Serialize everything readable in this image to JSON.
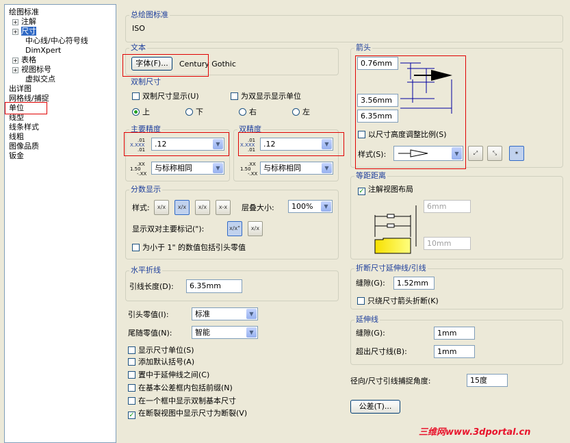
{
  "tree": {
    "items": [
      {
        "label": "绘图标准",
        "expander": ""
      },
      {
        "label": "注解",
        "expander": "+"
      },
      {
        "label": "尺寸",
        "expander": "+"
      },
      {
        "label": "中心线/中心符号线",
        "expander": ""
      },
      {
        "label": "DimXpert",
        "expander": ""
      },
      {
        "label": "表格",
        "expander": "+"
      },
      {
        "label": "视图标号",
        "expander": "+"
      },
      {
        "label": "虚拟交点",
        "expander": ""
      },
      {
        "label": "出详图",
        "expander": ""
      },
      {
        "label": "网格线/捕捉",
        "expander": ""
      },
      {
        "label": "单位",
        "expander": ""
      },
      {
        "label": "线型",
        "expander": ""
      },
      {
        "label": "线条样式",
        "expander": ""
      },
      {
        "label": "线粗",
        "expander": ""
      },
      {
        "label": "图像品质",
        "expander": ""
      },
      {
        "label": "钣金",
        "expander": ""
      }
    ]
  },
  "standard": {
    "label": "总绘图标准",
    "value": "ISO"
  },
  "text": {
    "label": "文本",
    "font_button": "字体(F)...",
    "font_name": "Century Gothic"
  },
  "dual": {
    "label": "双制尺寸",
    "show_dual": "双制尺寸显示(U)",
    "show_units": "为双显示显示单位",
    "top": "上",
    "bottom": "下",
    "right": "右",
    "left": "左"
  },
  "primary": {
    "label": "主要精度",
    "value": ".12",
    "tol": "与标称相同",
    "icon_top": ".01",
    "icon_mid": "X.XXX",
    "icon_bot": ".01",
    "tol_icon_top": ".XX",
    "tol_icon_mid": "1.50",
    "tol_icon_bot": "-.XX"
  },
  "dual_prec": {
    "label": "双精度",
    "value": ".12",
    "tol": "与标称相同",
    "icon_top": ".01",
    "icon_mid": "X.XXX",
    "icon_bot": ".01",
    "tol_icon_top": ".XX",
    "tol_icon_mid": "1.50",
    "tol_icon_bot": "-.XX"
  },
  "fraction": {
    "label": "分数显示",
    "style_label": "样式:",
    "stack_label": "层叠大小:",
    "stack_value": "100%",
    "dual_label": "显示双对主要标记(\"):",
    "include_zero": "为小于 1\" 的数值包括引头零值",
    "style_btns": [
      "x/x",
      "x/x",
      "x/x",
      "x-x"
    ],
    "dual_btns": [
      "x/x\"",
      "x/x"
    ]
  },
  "break": {
    "label": "水平折线",
    "length_label": "引线长度(D):",
    "length_value": "6.35mm"
  },
  "zeros": {
    "leading_label": "引头零值(I):",
    "leading_value": "标准",
    "trailing_label": "尾随零值(N):",
    "trailing_value": "智能"
  },
  "checks": [
    {
      "label": "显示尺寸单位(S)",
      "checked": false
    },
    {
      "label": "添加默认括号(A)",
      "checked": false
    },
    {
      "label": "置中于延伸线之间(C)",
      "checked": false
    },
    {
      "label": "在基本公差框内包括前缀(N)",
      "checked": false
    },
    {
      "label": "在一个框中显示双制基本尺寸",
      "checked": false
    },
    {
      "label": "在断裂视图中显示尺寸为断裂(V)",
      "checked": true
    }
  ],
  "arrows": {
    "label": "箭头",
    "v1": "0.76mm",
    "v2": "3.56mm",
    "v3": "6.35mm",
    "scale_label": "以尺寸高度调整比例(S)",
    "style_label": "样式(S):"
  },
  "offset": {
    "label": "等距距离",
    "annot_label": "注解视图布局",
    "v1": "6mm",
    "v2": "10mm"
  },
  "break_ext": {
    "label": "折断尺寸延伸线/引线",
    "gap_label": "缝隙(G):",
    "gap_value": "1.52mm",
    "only_label": "只绕尺寸箭头折断(K)"
  },
  "ext": {
    "label": "延伸线",
    "gap_label": "缝隙(G):",
    "gap_value": "1mm",
    "beyond_label": "超出尺寸线(B):",
    "beyond_value": "1mm"
  },
  "radial": {
    "label": "径向/尺寸引线捕捉角度:",
    "value": "15度"
  },
  "tolerance_btn": "公差(T)...",
  "watermark": "三维网www.3dportal.cn",
  "colors": {
    "highlight": "#e00000",
    "group_label": "#1e3f9c",
    "selection": "#316ac5"
  }
}
